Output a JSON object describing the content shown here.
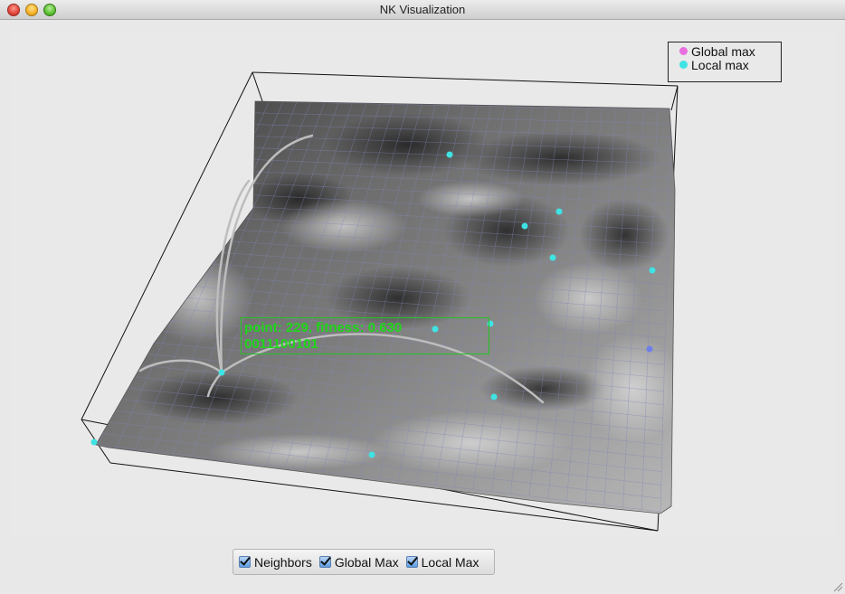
{
  "window": {
    "title": "NK Visualization"
  },
  "legend": {
    "items": [
      {
        "label": "Global max",
        "color": "#e86fe0"
      },
      {
        "label": "Local max",
        "color": "#3fe3e3"
      }
    ]
  },
  "selected_point": {
    "line1": "point: 229, fitness: 0.630",
    "line2": "0011100101"
  },
  "controls": {
    "checkboxes": [
      {
        "label": "Neighbors",
        "checked": true
      },
      {
        "label": "Global Max",
        "checked": true
      },
      {
        "label": "Local Max",
        "checked": true
      }
    ]
  },
  "colors": {
    "local_max": "#3fe3e3",
    "highlight": "#6f7fe8",
    "label_green": "#1fd61a"
  }
}
